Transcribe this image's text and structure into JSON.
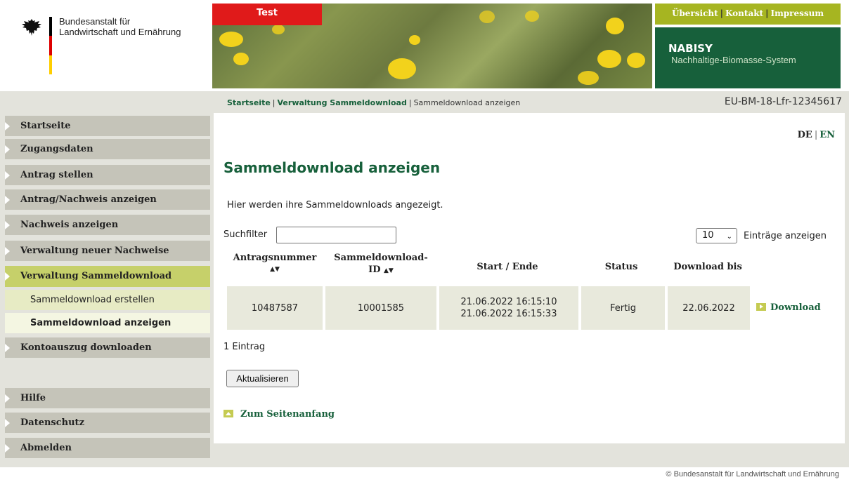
{
  "header": {
    "agency_line1": "Bundesanstalt für",
    "agency_line2": "Landwirtschaft und Ernährung",
    "test_badge": "Test",
    "topnav": [
      "Übersicht",
      "Kontakt",
      "Impressum"
    ],
    "app_title": "NABISY",
    "app_subtitle": "Nachhaltige-Biomasse-System",
    "flag_colors": [
      "#000000",
      "#dd0000",
      "#ffce00"
    ]
  },
  "breadcrumb": {
    "items": [
      "Startseite",
      "Verwaltung Sammeldownload",
      "Sammeldownload anzeigen"
    ]
  },
  "account_id": "EU-BM-18-Lfr-12345617",
  "sidebar": {
    "items": [
      "Startseite",
      "Zugangsdaten",
      "Antrag stellen",
      "Antrag/Nachweis anzeigen",
      "Nachweis anzeigen",
      "Verwaltung neuer Nachweise",
      "Verwaltung Sammeldownload",
      "Kontoauszug downloaden"
    ],
    "subitems": [
      "Sammeldownload erstellen",
      "Sammeldownload anzeigen"
    ],
    "bottom_items": [
      "Hilfe",
      "Datenschutz",
      "Abmelden"
    ]
  },
  "lang": {
    "de": "DE",
    "en": "EN"
  },
  "main": {
    "title": "Sammeldownload anzeigen",
    "intro": "Hier werden ihre Sammeldownloads angezeigt.",
    "search_label": "Suchfilter",
    "search_value": "",
    "entries_value": "10",
    "entries_label": "Einträge anzeigen",
    "table": {
      "headers": [
        "Antragsnummer",
        "Sammeldownload-",
        "ID",
        "Start / Ende",
        "Status",
        "Download bis"
      ],
      "sort_indicator": "▲▼",
      "row": {
        "antragsnummer": "10487587",
        "id": "10001585",
        "start": "21.06.2022 16:15:10",
        "ende": "21.06.2022 16:15:33",
        "status": "Fertig",
        "download_bis": "22.06.2022"
      },
      "download_label": "Download"
    },
    "count": "1 Eintrag",
    "refresh_label": "Aktualisieren",
    "top_link": "Zum Seitenanfang"
  },
  "footer": "© Bundesanstalt für Landwirtschaft und Ernährung",
  "colors": {
    "brand_green": "#17603b",
    "lime": "#a6b521",
    "test_red": "#e01a1a"
  }
}
